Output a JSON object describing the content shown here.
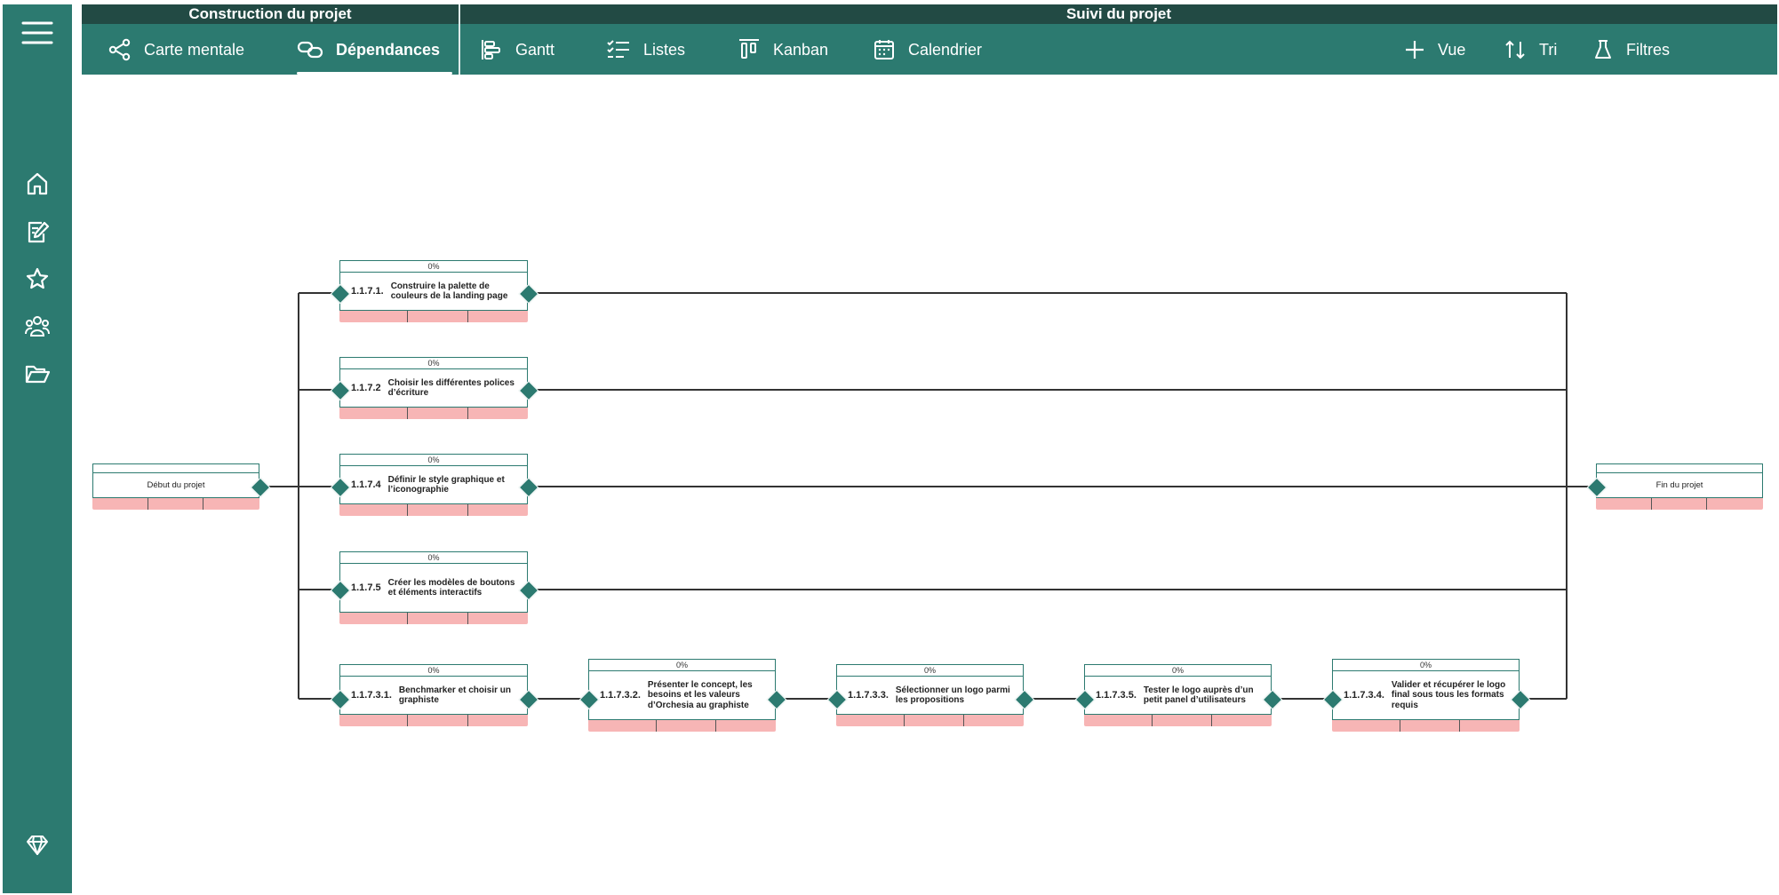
{
  "header": {
    "section_construction": "Construction du projet",
    "section_tracking": "Suivi du projet"
  },
  "tabs": [
    {
      "label": "Carte mentale",
      "icon": "share-nodes-icon"
    },
    {
      "label": "Dépendances",
      "icon": "link-icon",
      "active": true
    },
    {
      "label": "Gantt",
      "icon": "gantt-icon"
    },
    {
      "label": "Listes",
      "icon": "checklist-icon"
    },
    {
      "label": "Kanban",
      "icon": "kanban-icon"
    },
    {
      "label": "Calendrier",
      "icon": "calendar-icon"
    }
  ],
  "actions": [
    {
      "label": "Vue",
      "icon": "plus-icon"
    },
    {
      "label": "Tri",
      "icon": "sort-icon"
    },
    {
      "label": "Filtres",
      "icon": "flask-icon"
    }
  ],
  "sidebar": {
    "icons": [
      "menu-icon",
      "home-icon",
      "edit-document-icon",
      "star-icon",
      "team-icon",
      "folder-open-icon",
      "diamond-icon"
    ]
  },
  "colors": {
    "primary": "#2c7a70",
    "header_dark": "#224a44",
    "progress_bar": "#f7b5b5",
    "link_line": "#333333"
  },
  "milestones": {
    "start": "Début du projet",
    "end": "Fin du projet"
  },
  "tasks": [
    {
      "code": "1.1.7.1.",
      "title": "Construire la palette de couleurs de la landing page",
      "progress": "0%"
    },
    {
      "code": "1.1.7.2",
      "title": "Choisir les différentes polices d’écriture",
      "progress": "0%"
    },
    {
      "code": "1.1.7.4",
      "title": "Définir le style graphique et l’iconographie",
      "progress": "0%"
    },
    {
      "code": "1.1.7.5",
      "title": "Créer les modèles de boutons et éléments interactifs",
      "progress": "0%"
    },
    {
      "code": "1.1.7.3.1.",
      "title": "Benchmarker et choisir un graphiste",
      "progress": "0%"
    },
    {
      "code": "1.1.7.3.2.",
      "title": "Présenter le concept, les besoins et les valeurs d’Orchesia au graphiste",
      "progress": "0%"
    },
    {
      "code": "1.1.7.3.3.",
      "title": "Sélectionner un logo parmi les propositions",
      "progress": "0%"
    },
    {
      "code": "1.1.7.3.5.",
      "title": "Tester le logo auprès d’un petit panel d’utilisateurs",
      "progress": "0%"
    },
    {
      "code": "1.1.7.3.4.",
      "title": "Valider et récupérer le logo final sous tous les formats requis",
      "progress": "0%"
    }
  ]
}
